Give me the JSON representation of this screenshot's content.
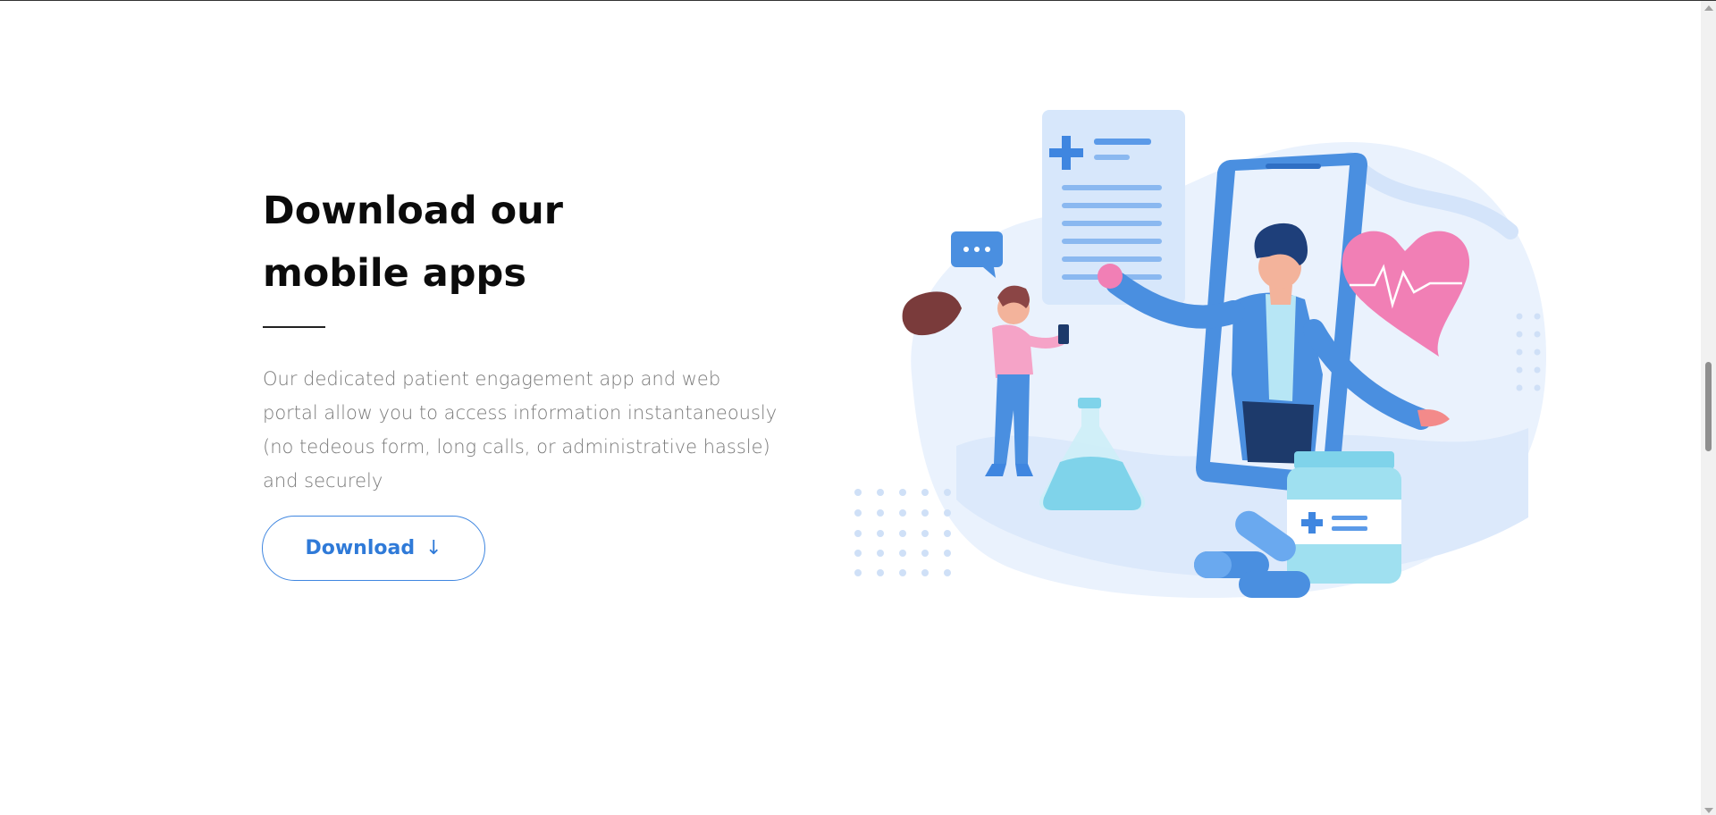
{
  "section": {
    "title_line1": "Download our",
    "title_line2": "mobile apps",
    "description": "Our dedicated patient engagement app and web portal allow you to access information instantaneously (no tedeous form, long calls, or administrative hassle) and securely",
    "download_button": {
      "label": "Download",
      "icon": "arrow-down-icon",
      "arrow_glyph": "↓"
    }
  },
  "illustration": {
    "name": "doctor-mobile-app-illustration",
    "chat_bubble_text": "..."
  },
  "colors": {
    "accent": "#2f7ad8",
    "title": "#0b0b0b",
    "body_text": "#7a7a7a",
    "illustration_blue": "#4a8fe0",
    "illustration_pink": "#f17fb5"
  }
}
